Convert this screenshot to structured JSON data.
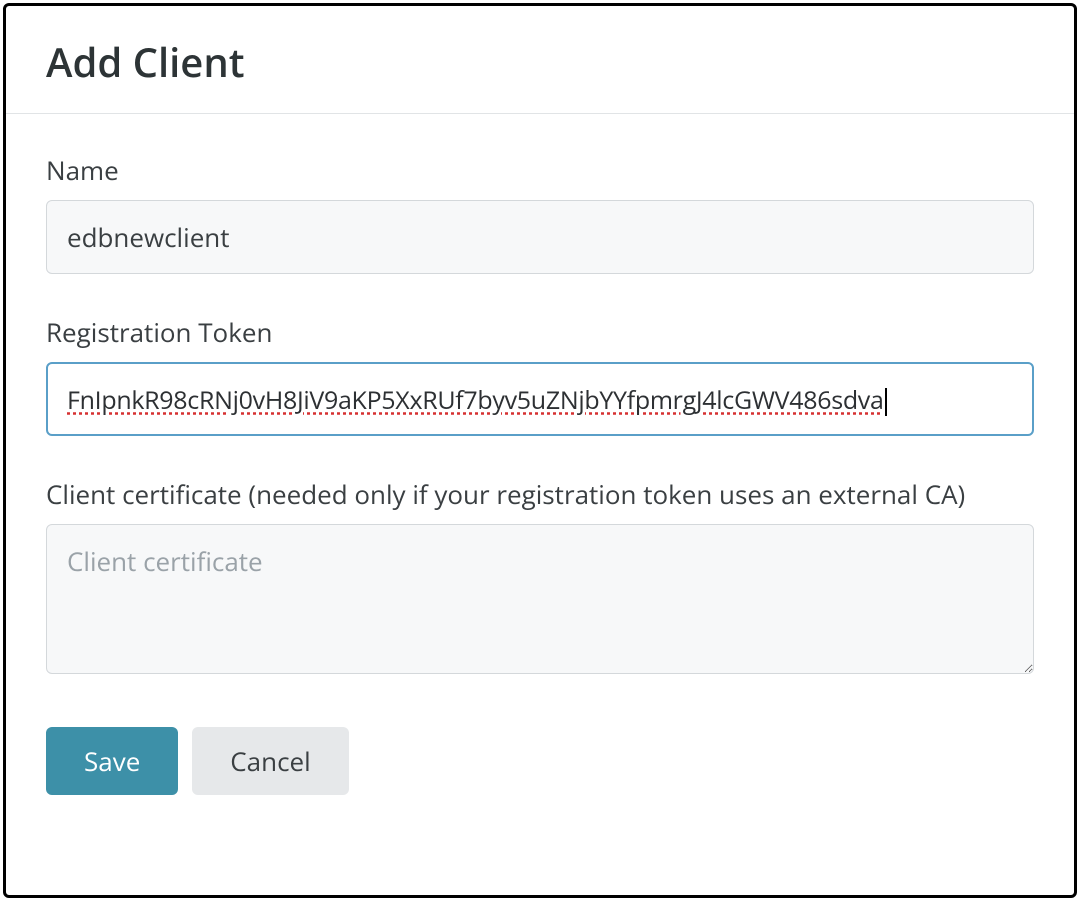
{
  "dialog": {
    "title": "Add Client"
  },
  "form": {
    "name_label": "Name",
    "name_value": "edbnewclient",
    "token_label": "Registration Token",
    "token_value": "FnIpnkR98cRNj0vH8JiV9aKP5XxRUf7byv5uZNjbYYfpmrgJ4lcGWV486sdva",
    "cert_label": "Client certificate (needed only if your registration token uses an external CA)",
    "cert_placeholder": "Client certificate",
    "cert_value": ""
  },
  "buttons": {
    "save": "Save",
    "cancel": "Cancel"
  }
}
